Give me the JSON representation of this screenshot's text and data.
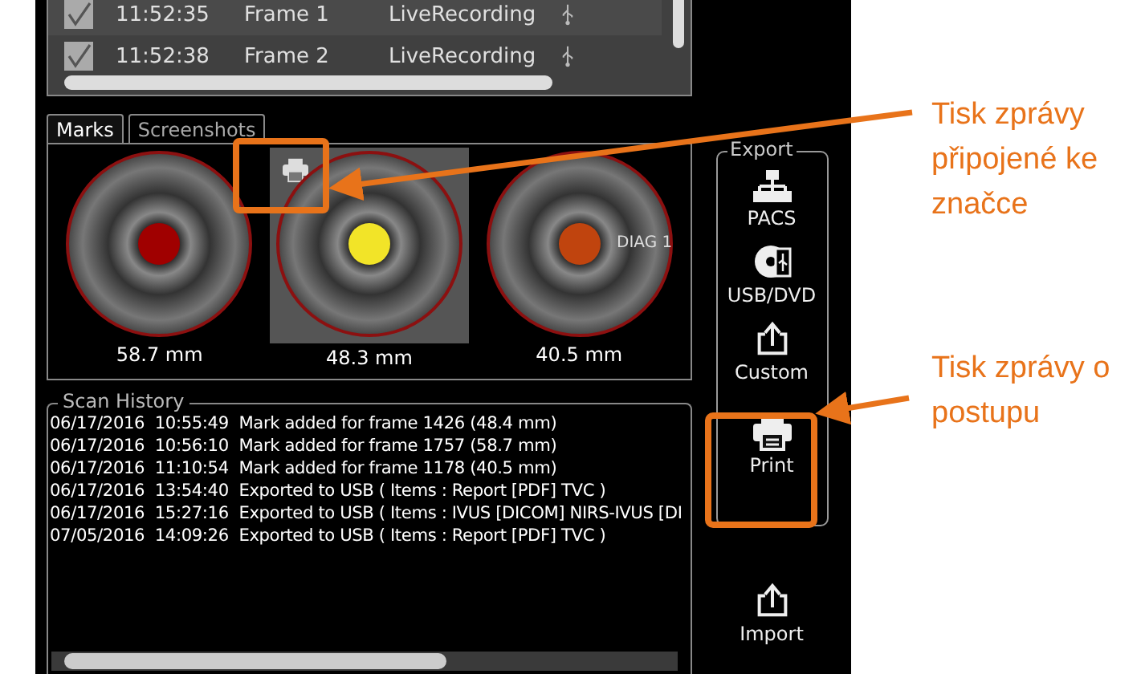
{
  "recordings": [
    {
      "checked": true,
      "time": "11:52:35",
      "frame": "Frame 1",
      "source": "LiveRecording"
    },
    {
      "checked": true,
      "time": "11:52:38",
      "frame": "Frame 2",
      "source": "LiveRecording"
    }
  ],
  "tabs": [
    {
      "label": "Marks",
      "selected": true
    },
    {
      "label": "Screenshots",
      "selected": false
    }
  ],
  "marks": [
    {
      "distance": "58.7 mm",
      "color": "#a00000",
      "selected": false
    },
    {
      "distance": "48.3 mm",
      "color": "#f2e428",
      "selected": true
    },
    {
      "distance": "40.5 mm",
      "color": "#c0440e",
      "selected": false,
      "label": "DIAG 1"
    }
  ],
  "scan_history": {
    "title": "Scan History",
    "entries": [
      "06/17/2016  10:55:49  Mark added for frame 1426 (48.4 mm)",
      "06/17/2016  10:56:10  Mark added for frame 1757 (58.7 mm)",
      "06/17/2016  11:10:54  Mark added for frame 1178 (40.5 mm)",
      "06/17/2016  13:54:40  Exported to USB ( Items : Report [PDF] TVC )",
      "06/17/2016  15:27:16  Exported to USB ( Items : IVUS [DICOM] NIRS-IVUS [DI",
      "07/05/2016  14:09:26  Exported to USB ( Items : Report [PDF] TVC )"
    ]
  },
  "export": {
    "title": "Export",
    "buttons": [
      {
        "kind": "pacs",
        "label": "PACS"
      },
      {
        "kind": "usb",
        "label": "USB/DVD"
      },
      {
        "kind": "custom",
        "label": "Custom"
      },
      {
        "kind": "print",
        "label": "Print"
      }
    ]
  },
  "import_button": {
    "label": "Import"
  },
  "annotations": [
    {
      "text": "Tisk zprávy připojené ke značce"
    },
    {
      "text": "Tisk zprávy o postupu"
    }
  ]
}
